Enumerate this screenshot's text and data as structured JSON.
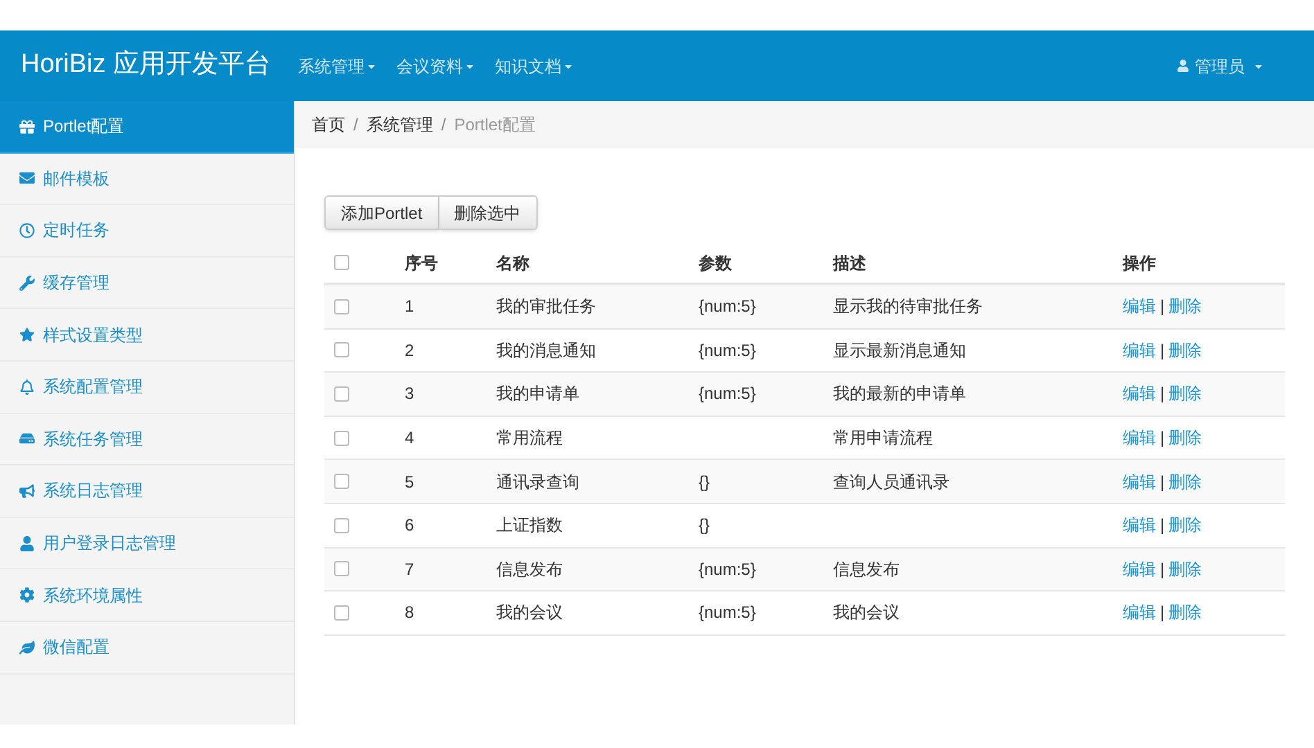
{
  "header": {
    "brand": "HoriBiz 应用开发平台",
    "menus": [
      "系统管理",
      "会议资料",
      "知识文档"
    ],
    "user": "管理员"
  },
  "sidebar": {
    "items": [
      {
        "label": "Portlet配置",
        "selected": true
      },
      {
        "label": "邮件模板",
        "selected": false
      },
      {
        "label": "定时任务",
        "selected": false
      },
      {
        "label": "缓存管理",
        "selected": false
      },
      {
        "label": "样式设置类型",
        "selected": false
      },
      {
        "label": "系统配置管理",
        "selected": false
      },
      {
        "label": "系统任务管理",
        "selected": false
      },
      {
        "label": "系统日志管理",
        "selected": false
      },
      {
        "label": "用户登录日志管理",
        "selected": false
      },
      {
        "label": "系统环境属性",
        "selected": false
      },
      {
        "label": "微信配置",
        "selected": false
      }
    ]
  },
  "breadcrumb": {
    "items": [
      "首页",
      "系统管理",
      "Portlet配置"
    ],
    "separators": [
      "/",
      "/"
    ]
  },
  "toolbar": {
    "buttons": [
      "添加Portlet",
      "删除选中"
    ]
  },
  "table": {
    "header_checked": false,
    "columns": [
      "序号",
      "名称",
      "参数",
      "描述",
      "操作"
    ],
    "rows": [
      {
        "checked": false,
        "cells": [
          "1",
          "我的审批任务",
          "{num:5}",
          "显示我的待审批任务"
        ],
        "actions": {
          "edit": "编辑",
          "separator": "|",
          "delete": "删除"
        }
      },
      {
        "checked": false,
        "cells": [
          "2",
          "我的消息通知",
          "{num:5}",
          "显示最新消息通知"
        ],
        "actions": {
          "edit": "编辑",
          "separator": "|",
          "delete": "删除"
        }
      },
      {
        "checked": false,
        "cells": [
          "3",
          "我的申请单",
          "{num:5}",
          "我的最新的申请单"
        ],
        "actions": {
          "edit": "编辑",
          "separator": "|",
          "delete": "删除"
        }
      },
      {
        "checked": false,
        "cells": [
          "4",
          "常用流程",
          "",
          "常用申请流程"
        ],
        "actions": {
          "edit": "编辑",
          "separator": "|",
          "delete": "删除"
        }
      },
      {
        "checked": false,
        "cells": [
          "5",
          "通讯录查询",
          "{}",
          "查询人员通讯录"
        ],
        "actions": {
          "edit": "编辑",
          "separator": "|",
          "delete": "删除"
        }
      },
      {
        "checked": false,
        "cells": [
          "6",
          "上证指数",
          "{}",
          ""
        ],
        "actions": {
          "edit": "编辑",
          "separator": "|",
          "delete": "删除"
        }
      },
      {
        "checked": false,
        "cells": [
          "7",
          "信息发布",
          "{num:5}",
          "信息发布"
        ],
        "actions": {
          "edit": "编辑",
          "separator": "|",
          "delete": "删除"
        }
      },
      {
        "checked": false,
        "cells": [
          "8",
          "我的会议",
          "{num:5}",
          "我的会议"
        ],
        "actions": {
          "edit": "编辑",
          "separator": "|",
          "delete": "删除"
        }
      }
    ]
  }
}
